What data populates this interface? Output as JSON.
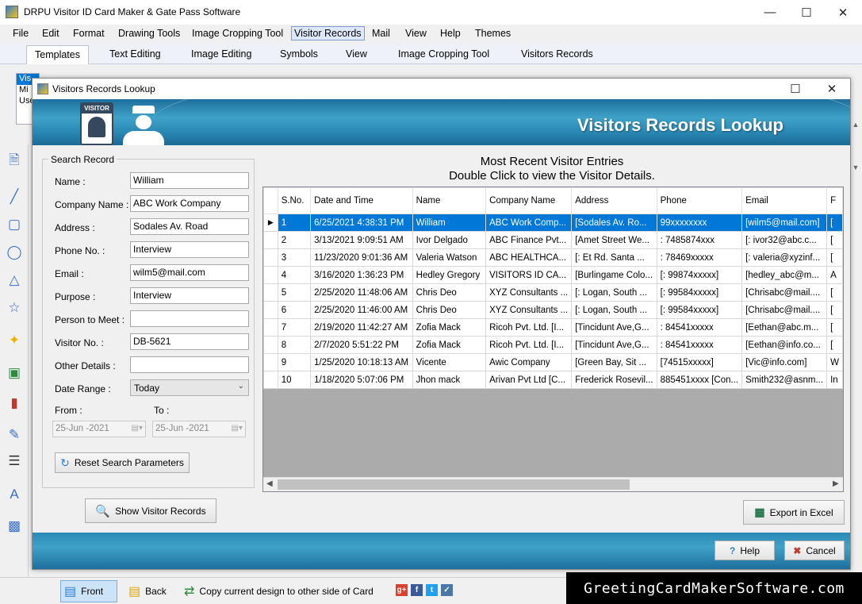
{
  "window": {
    "title": "DRPU Visitor ID Card Maker & Gate Pass Software"
  },
  "menu": [
    "File",
    "Edit",
    "Format",
    "Drawing Tools",
    "Image Cropping Tool",
    "Visitor Records",
    "Mail",
    "View",
    "Help",
    "Themes"
  ],
  "tabs": [
    "Templates",
    "Text Editing",
    "Image Editing",
    "Symbols",
    "View",
    "Image Cropping Tool",
    "Visitors Records"
  ],
  "behind_list": [
    "Vis",
    "Mi",
    "Use"
  ],
  "dialog": {
    "title": "Visitors Records Lookup",
    "banner_title": "Visitors Records Lookup",
    "badge_text": "VISITOR"
  },
  "search": {
    "legend": "Search Record",
    "fields": [
      {
        "label": "Name :",
        "value": "William"
      },
      {
        "label": "Company Name :",
        "value": "ABC Work Company"
      },
      {
        "label": "Address :",
        "value": "Sodales Av. Road"
      },
      {
        "label": "Phone No. :",
        "value": "Interview"
      },
      {
        "label": "Email :",
        "value": "wilm5@mail.com"
      },
      {
        "label": "Purpose :",
        "value": "Interview"
      },
      {
        "label": "Person to Meet :",
        "value": ""
      },
      {
        "label": "Visitor No. :",
        "value": "DB-5621"
      },
      {
        "label": "Other Details :",
        "value": ""
      },
      {
        "label": "Date Range :",
        "value": "Today"
      }
    ],
    "from_label": "From :",
    "to_label": "To :",
    "from_date": "25-Jun -2021",
    "to_date": "25-Jun -2021",
    "reset_button": "Reset Search Parameters",
    "show_button": "Show Visitor Records"
  },
  "grid": {
    "heading1": "Most Recent Visitor Entries",
    "heading2": "Double Click to view the Visitor Details.",
    "columns": [
      "S.No.",
      "Date and Time",
      "Name",
      "Company Name",
      "Address",
      "Phone",
      "Email",
      "F"
    ],
    "rows": [
      [
        "1",
        "6/25/2021 4:38:31 PM",
        "William",
        "ABC Work Comp...",
        "[Sodales Av. Ro...",
        "99xxxxxxxx",
        "[wilm5@mail.com]",
        "["
      ],
      [
        "2",
        "3/13/2021 9:09:51 AM",
        "Ivor Delgado",
        "ABC Finance Pvt...",
        "[Amet Street We...",
        ":  7485874xxx",
        "[: ivor32@abc.c...",
        "["
      ],
      [
        "3",
        "11/23/2020 9:01:36 AM",
        "Valeria Watson",
        "ABC HEALTHCA...",
        "[: Et Rd. Santa  ...",
        ": 78469xxxxx",
        "[: valeria@xyzinf...",
        "["
      ],
      [
        "4",
        "3/16/2020 1:36:23 PM",
        "Hedley Gregory",
        "VISITORS ID CA...",
        "[Burlingame Colo...",
        "[: 99874xxxxx]",
        "[hedley_abc@m...",
        "A"
      ],
      [
        "5",
        "2/25/2020 11:48:06 AM",
        "Chris Deo",
        "XYZ Consultants ...",
        "[: Logan, South  ...",
        "[: 99584xxxxx]",
        "[Chrisabc@mail....",
        "["
      ],
      [
        "6",
        "2/25/2020 11:46:00 AM",
        "Chris Deo",
        "XYZ Consultants ...",
        "[: Logan, South  ...",
        "[: 99584xxxxx]",
        "[Chrisabc@mail....",
        "["
      ],
      [
        "7",
        "2/19/2020 11:42:27 AM",
        "Zofia Mack",
        "Ricoh Pvt. Ltd. [I...",
        "[Tincidunt Ave,G...",
        ": 84541xxxxx",
        "[Eethan@abc.m...",
        "["
      ],
      [
        "8",
        "2/7/2020 5:51:22 PM",
        "Zofia Mack",
        "Ricoh Pvt. Ltd. [I...",
        "[Tincidunt Ave,G...",
        ": 84541xxxxx",
        "[Eethan@info.co...",
        "["
      ],
      [
        "9",
        "1/25/2020 10:18:13 AM",
        "Vicente",
        "Awic Company",
        "[Green Bay, Sit  ...",
        "[74515xxxxx]",
        "[Vic@info.com]",
        "W"
      ],
      [
        "10",
        "1/18/2020 5:07:06 PM",
        "Jhon mack",
        "Arivan Pvt Ltd [C...",
        "Frederick Rosevil...",
        "885451xxxx [Con...",
        "Smith232@asnm...",
        "In"
      ]
    ],
    "selected_row": 0
  },
  "buttons": {
    "export": "Export in Excel",
    "help": "Help",
    "cancel": "Cancel"
  },
  "bottom": {
    "front": "Front",
    "back": "Back",
    "copy": "Copy current design to other side of Card"
  },
  "brand": "GreetingCardMakerSoftware.com",
  "colors": {
    "selection": "#0078d7",
    "banner": "#2b89b5",
    "brand_bg": "#000000"
  }
}
